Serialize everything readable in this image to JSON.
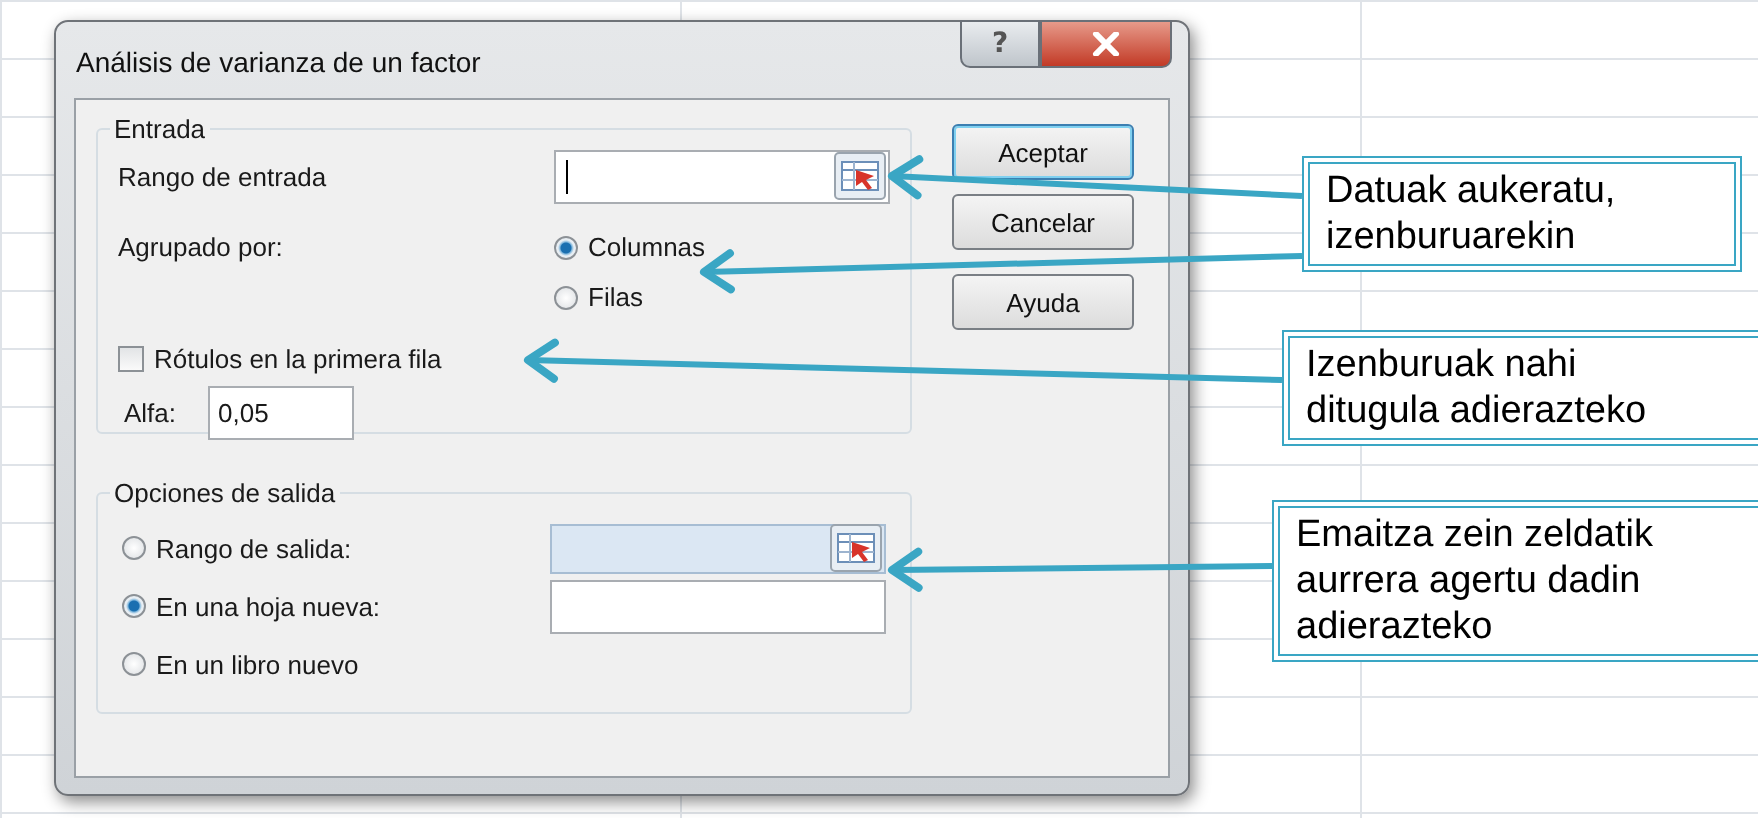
{
  "window": {
    "title": "Análisis de varianza de un factor",
    "help_button": "?"
  },
  "entrada": {
    "legend": "Entrada",
    "input_range": {
      "label": "Rango de entrada",
      "focused": true
    },
    "grouped_by": {
      "label": "Agrupado por:",
      "options": [
        {
          "label": "Columnas",
          "selected": true
        },
        {
          "label": "Filas",
          "selected": false
        }
      ]
    },
    "labels_first_row": {
      "label": "Rótulos en la primera fila",
      "checked": false
    },
    "alpha": {
      "label": "Alfa:",
      "value": "0,05"
    }
  },
  "output": {
    "legend": "Opciones de salida",
    "options": [
      {
        "label": "Rango de salida:",
        "selected": false,
        "kind": "range"
      },
      {
        "label": "En una hoja nueva:",
        "selected": true,
        "kind": "text"
      },
      {
        "label": "En un libro nuevo",
        "selected": false,
        "kind": "none"
      }
    ]
  },
  "buttons": [
    {
      "label": "Aceptar",
      "default": true
    },
    {
      "label": "Cancelar",
      "default": false
    },
    {
      "label": "Ayuda",
      "default": false
    }
  ],
  "callouts": [
    {
      "lines": [
        "Datuak aukeratu,",
        "izenburuarekin"
      ]
    },
    {
      "lines": [
        "Izenburuak nahi",
        "ditugula adierazteko"
      ]
    },
    {
      "lines": [
        "Emaitza zein zeldatik",
        "aurrera agertu dadin",
        "adierazteko"
      ]
    }
  ]
}
